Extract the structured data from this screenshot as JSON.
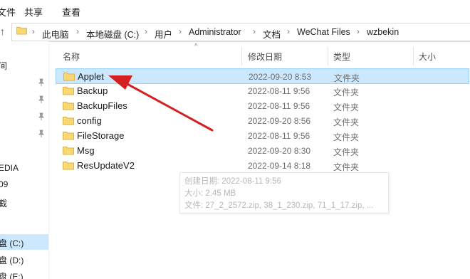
{
  "ribbon": {
    "tabs": [
      "文件",
      "共享",
      "查看"
    ]
  },
  "address": {
    "crumbs": [
      "此电脑",
      "本地磁盘 (C:)",
      "用户",
      "Administrator",
      "文档",
      "WeChat Files",
      "wzbekin"
    ]
  },
  "nav": {
    "items": [
      "间",
      "EDIA",
      "09",
      "截",
      "盘 (C:)",
      "盘 (D:)",
      "盘 (E:)"
    ]
  },
  "columns": {
    "name": "名称",
    "modified": "修改日期",
    "type": "类型",
    "size": "大小"
  },
  "files": [
    {
      "name": "Applet",
      "modified": "2022-09-20 8:53",
      "type": "文件夹"
    },
    {
      "name": "Backup",
      "modified": "2022-08-11 9:56",
      "type": "文件夹"
    },
    {
      "name": "BackupFiles",
      "modified": "2022-08-11 9:56",
      "type": "文件夹"
    },
    {
      "name": "config",
      "modified": "2022-09-20 8:56",
      "type": "文件夹"
    },
    {
      "name": "FileStorage",
      "modified": "2022-08-11 9:56",
      "type": "文件夹"
    },
    {
      "name": "Msg",
      "modified": "2022-09-20 8:30",
      "type": "文件夹"
    },
    {
      "name": "ResUpdateV2",
      "modified": "2022-09-14 8:18",
      "type": "文件夹"
    }
  ],
  "tooltip": {
    "created": "创建日期: 2022-08-11 9:56",
    "size": "大小: 2.45 MB",
    "files": "文件: 27_2_2572.zip, 38_1_230.zip, 71_1_17.zip, ..."
  },
  "colors": {
    "selection": "#cce8ff",
    "selection_border": "#99d1ff",
    "folder": "#f8d775",
    "annotation_arrow": "#d42020"
  }
}
